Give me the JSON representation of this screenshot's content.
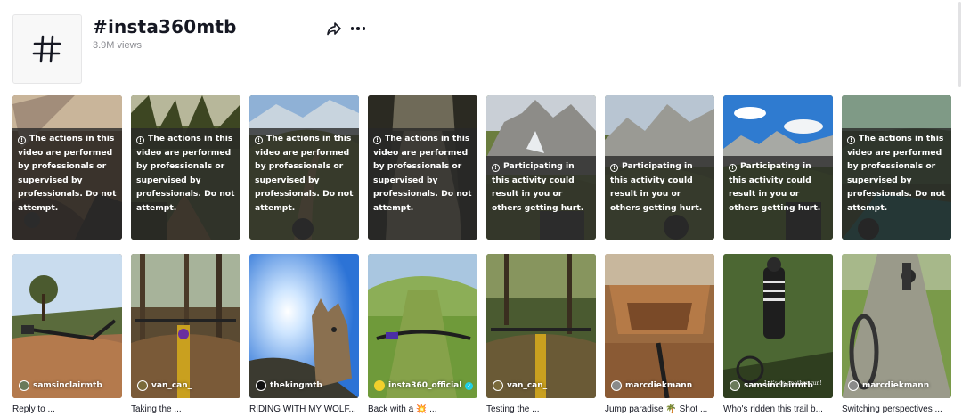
{
  "hashtag": {
    "title": "#insta360mtb",
    "views": "3.9M views",
    "icon": "hashtag-icon"
  },
  "actions": {
    "share_icon": "share-icon",
    "more_icon": "more-icon"
  },
  "warnings": {
    "pro": "The actions in this video are performed by professionals or supervised by professionals. Do not attempt.",
    "participating": "Participating in this activity could result in you or others getting hurt."
  },
  "row1": [
    {
      "warning": "The actions in this video are performed by professionals or supervised by professionals. Do not attempt."
    },
    {
      "warning": "The actions in this video are performed by professionals or supervised by professionals. Do not attempt."
    },
    {
      "warning": "The actions in this video are performed by professionals or supervised by professionals. Do not attempt."
    },
    {
      "warning": "The actions in this video are performed by professionals or supervised by professionals. Do not attempt."
    },
    {
      "warning": "Participating in this activity could result in you or others getting hurt."
    },
    {
      "warning": "Participating in this activity could result in you or others getting hurt."
    },
    {
      "warning": "Participating in this activity could result in you or others getting hurt."
    },
    {
      "warning": "The actions in this video are performed by professionals or supervised by professionals. Do not attempt."
    }
  ],
  "row2": [
    {
      "author": "samsinclairmtb",
      "caption": "Reply to ..."
    },
    {
      "author": "van_can_",
      "caption": "Taking the ..."
    },
    {
      "author": "thekingmtb",
      "caption": "RIDING WITH MY WOLF..."
    },
    {
      "author": "insta360_official",
      "caption": "Back with a 💥 ..."
    },
    {
      "author": "van_can_",
      "caption": "Testing the ..."
    },
    {
      "author": "marcdiekmann",
      "caption": "Jump paradise 🌴 Shot ..."
    },
    {
      "author": "samsinclairmtb",
      "caption": "Who's ridden this trail b..."
    },
    {
      "author": "marcdiekmann",
      "caption": "Switching perspectives ..."
    }
  ],
  "overlay_text": "Let's do another run!"
}
